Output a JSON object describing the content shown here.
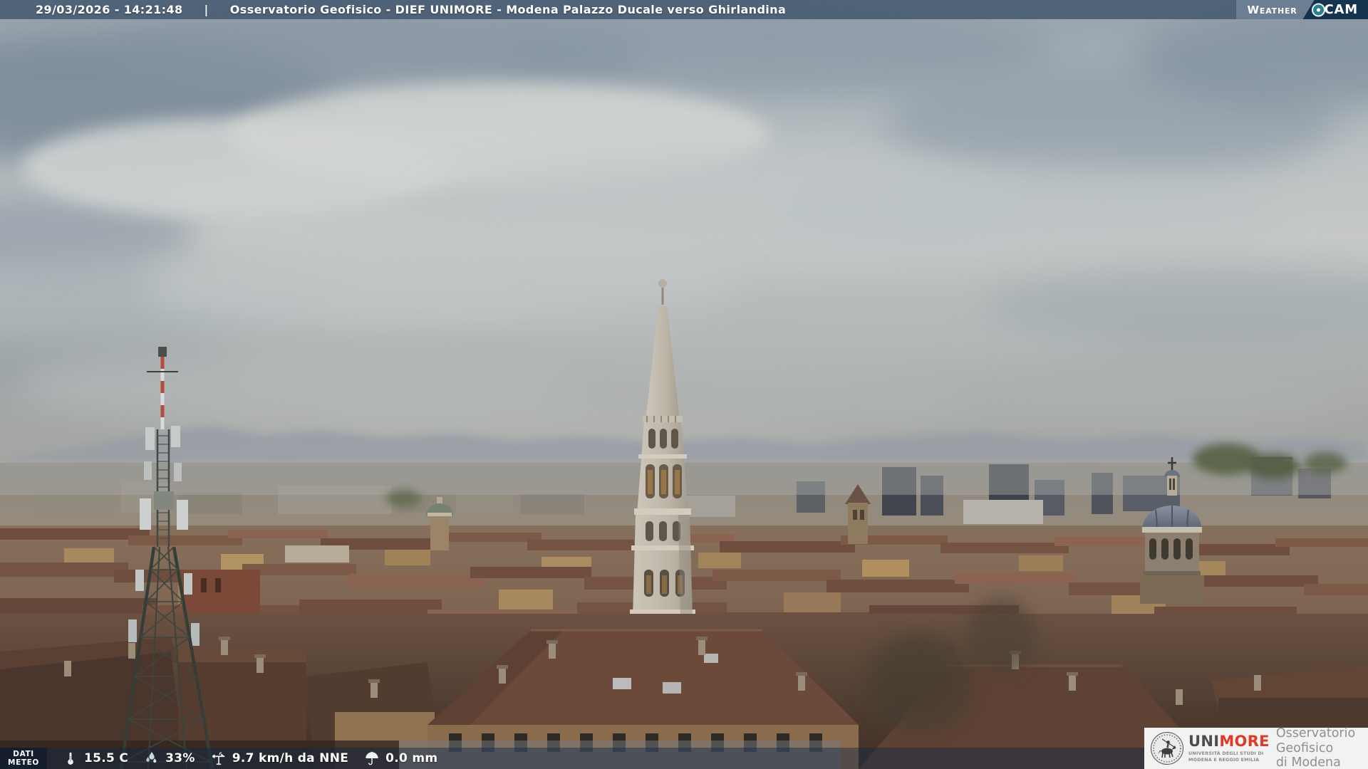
{
  "header": {
    "timestamp": "29/03/2026 - 14:21:48",
    "separator": "|",
    "title": "Osservatorio Geofisico - DIEF UNIMORE - Modena Palazzo Ducale verso Ghirlandina"
  },
  "weathercam": {
    "weather": "Weather",
    "cam": "CAM"
  },
  "meteo": {
    "label_line1": "DATI",
    "label_line2": "METEO",
    "temperature": "15.5 C",
    "humidity": "33%",
    "wind": "9.7 km/h da NNE",
    "precipitation": "0.0 mm"
  },
  "unimore": {
    "uni": "UNI",
    "more": "MORE",
    "tagline1": "UNIVERSITÀ DEGLI STUDI DI",
    "tagline2": "MODENA E REGGIO EMILIA",
    "org1": "Osservatorio Geofisico",
    "org2": "di Modena"
  },
  "colors": {
    "topbar_blue": "#3e546c",
    "weathercam_navy": "#16334d",
    "lens_teal": "#2e7f8d",
    "more_red": "#e13a2b",
    "meteo_bar_navy": "#122844"
  },
  "icons": [
    "thermometer-icon",
    "humidity-drops-icon",
    "wind-vane-icon",
    "umbrella-icon",
    "camera-lens-icon",
    "unimore-seal-icon"
  ],
  "scene": {
    "description": "Overcast webcam view over the rooftops of Modena toward the Ghirlandina tower, with a telecom lattice tower at left, a lead-covered church dome at right and the Apennine hills on the horizon"
  }
}
